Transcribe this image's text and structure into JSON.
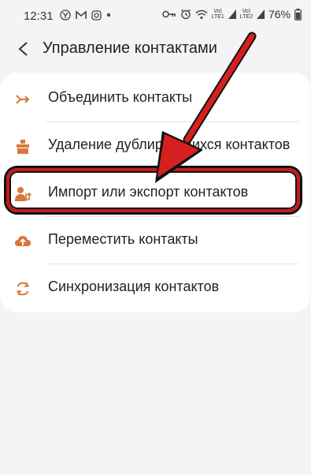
{
  "status_bar": {
    "time": "12:31",
    "battery_percent": "76%",
    "left_icons": [
      "yahoo-icon",
      "gmail-icon",
      "instagram-icon",
      "dot-icon"
    ],
    "right_icons": [
      "key-icon",
      "alarm-icon",
      "wifi-icon",
      "signal1-icon",
      "signal2-icon",
      "battery-icon"
    ],
    "sim1_label_top": "Vo)",
    "sim1_label_bottom": "LTE1",
    "sim2_label_top": "Vo)",
    "sim2_label_bottom": "LTE2"
  },
  "header": {
    "title": "Управление контактами",
    "back_icon": "chevron-left-icon"
  },
  "menu": {
    "items": [
      {
        "label": "Объединить контакты",
        "icon": "merge-icon"
      },
      {
        "label": "Удаление дублирующихся контактов",
        "icon": "delete-duplicates-icon"
      },
      {
        "label": "Импорт или экспорт контактов",
        "icon": "import-export-icon"
      },
      {
        "label": "Переместить контакты",
        "icon": "cloud-upload-icon"
      },
      {
        "label": "Синхронизация контактов",
        "icon": "sync-icon"
      }
    ]
  },
  "colors": {
    "accent_icon": "#d9773a",
    "annotation_red": "#d61f1f",
    "background": "#f4f4f6",
    "card": "#ffffff"
  },
  "annotation": {
    "highlighted_item": "Импорт или экспорт контактов"
  }
}
